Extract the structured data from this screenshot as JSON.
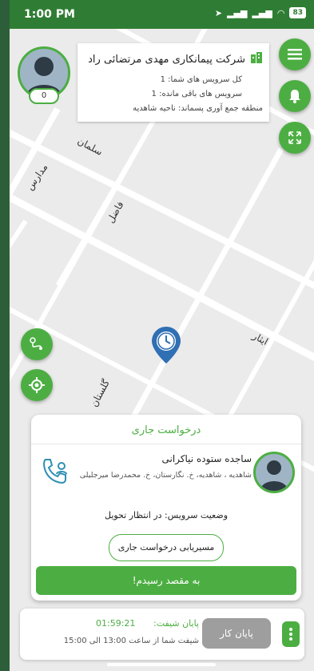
{
  "status": {
    "time": "1:00 PM",
    "battery": "83"
  },
  "company": {
    "name": "شرکت پیمانکاری مهدی مرتضائی راد",
    "total_services": "کل سرویس های شما: 1",
    "remaining_services": "سرویس های باقی مانده: 1",
    "zone": "منطقه جمع آوری پسماند: ناحیه شاهدیه"
  },
  "driver": {
    "count": "0"
  },
  "streets": [
    "سلمان",
    "مدارس",
    "فاضل",
    "ایثار",
    "گلستان"
  ],
  "request": {
    "title": "درخواست جاری",
    "customer_name": "ساجده ستوده نیاکرانی",
    "address": "شاهدیه ، شاهدیه، خ. نگارستان، خ. محمدرضا میرجلیلی",
    "status": "وضعیت سرویس: در انتظار تحویل",
    "route_label": "مسیریابی درخواست جاری",
    "arrive_label": "به مقصد رسیدم!"
  },
  "shift": {
    "end_label": "پایان شیفت:",
    "end_time": "01:59:21",
    "range": "شیفت شما از ساعت 13:00 الی 15:00",
    "end_work_label": "پایان کار"
  },
  "colors": {
    "accent": "#4cae42",
    "statusbar": "#2f7d34"
  }
}
